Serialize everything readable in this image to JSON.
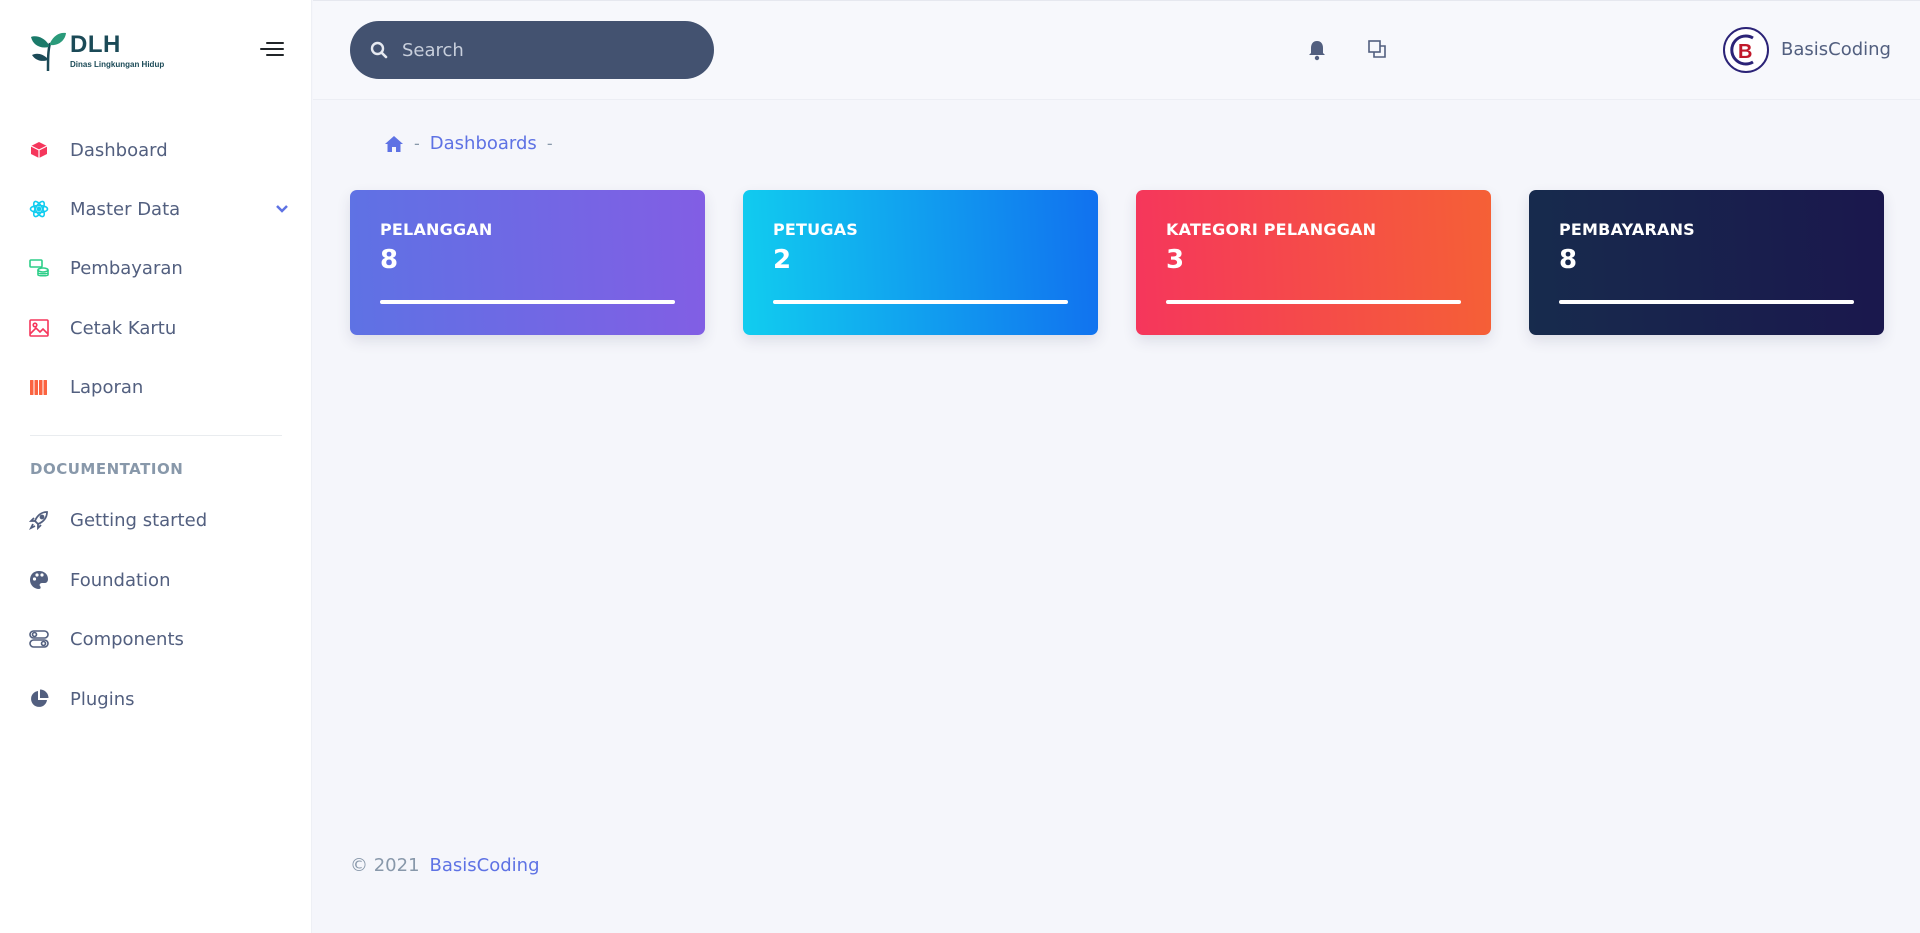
{
  "brand": {
    "title": "DLH",
    "subtitle": "Dinas Lingkungan Hidup"
  },
  "sidebar": {
    "items": [
      {
        "label": "Dashboard",
        "icon": "box-icon",
        "color": "#f5365c"
      },
      {
        "label": "Master Data",
        "icon": "atom-icon",
        "color": "#11cdef"
      },
      {
        "label": "Pembayaran",
        "icon": "coins-icon",
        "color": "#2dce89"
      },
      {
        "label": "Cetak Kartu",
        "icon": "image-icon",
        "color": "#f5365c"
      },
      {
        "label": "Laporan",
        "icon": "books-icon",
        "color": "#fb6340"
      }
    ],
    "doc_heading": "DOCUMENTATION",
    "doc_items": [
      {
        "label": "Getting started",
        "icon": "rocket-icon"
      },
      {
        "label": "Foundation",
        "icon": "palette-icon"
      },
      {
        "label": "Components",
        "icon": "toggles-icon"
      },
      {
        "label": "Plugins",
        "icon": "pie-chart-icon"
      }
    ]
  },
  "header": {
    "search_placeholder": "Search",
    "user_name": "BasisCoding",
    "avatar_letter": "B"
  },
  "breadcrumb": {
    "items": [
      "Dashboards"
    ]
  },
  "cards": [
    {
      "title": "PELANGGAN",
      "value": "8"
    },
    {
      "title": "PETUGAS",
      "value": "2"
    },
    {
      "title": "KATEGORI PELANGGAN",
      "value": "3"
    },
    {
      "title": "PEMBAYARANS",
      "value": "8"
    }
  ],
  "footer": {
    "copyright": "© 2021",
    "link": "BasisCoding"
  }
}
